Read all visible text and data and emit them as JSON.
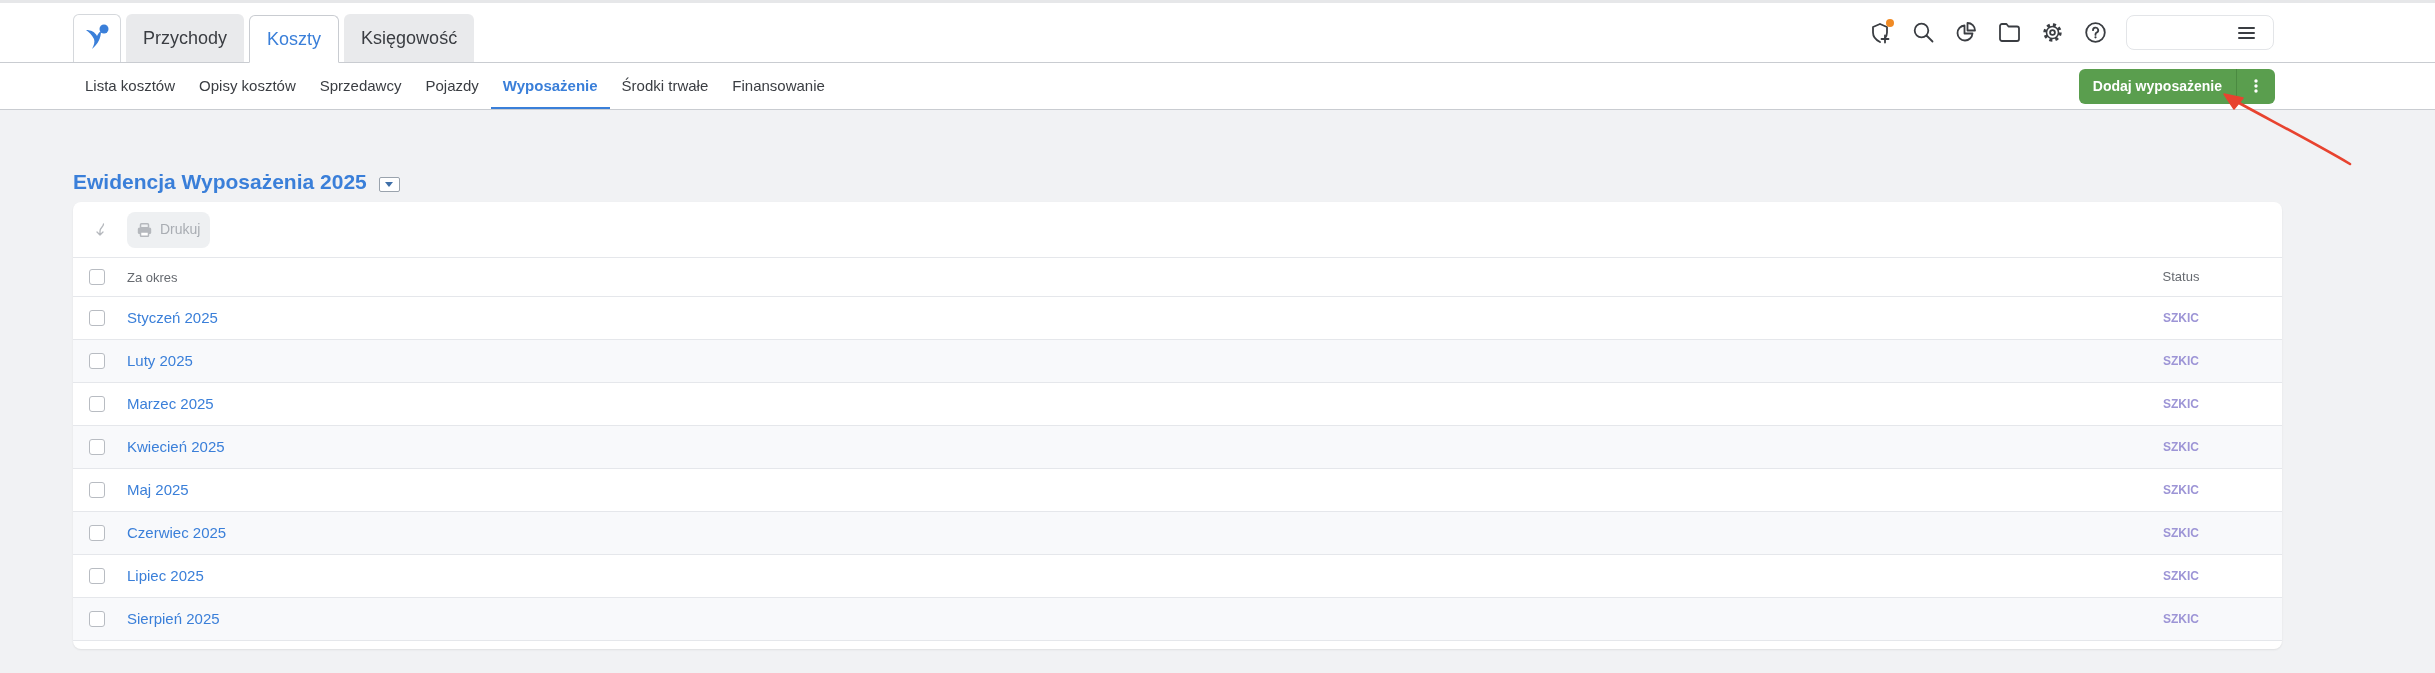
{
  "header": {
    "tabs": [
      {
        "label": "Przychody",
        "selected": false
      },
      {
        "label": "Koszty",
        "selected": true
      },
      {
        "label": "Księgowość",
        "selected": false
      }
    ],
    "alert_badge": true
  },
  "subnav": {
    "items": [
      {
        "label": "Lista kosztów",
        "selected": false
      },
      {
        "label": "Opisy kosztów",
        "selected": false
      },
      {
        "label": "Sprzedawcy",
        "selected": false
      },
      {
        "label": "Pojazdy",
        "selected": false
      },
      {
        "label": "Wyposażenie",
        "selected": true
      },
      {
        "label": "Środki trwałe",
        "selected": false
      },
      {
        "label": "Finansowanie",
        "selected": false
      }
    ],
    "primary_action": {
      "label": "Dodaj wyposażenie"
    }
  },
  "register": {
    "title": "Ewidencja Wyposażenia 2025",
    "toolbar": {
      "print": {
        "label": "Drukuj",
        "disabled": true
      }
    },
    "table": {
      "columns": [
        "Za okres",
        "Status"
      ],
      "header_checked": false,
      "rows": [
        {
          "period": "Styczeń 2025",
          "status": "SZKIC",
          "checked": false
        },
        {
          "period": "Luty 2025",
          "status": "SZKIC",
          "checked": false
        },
        {
          "period": "Marzec 2025",
          "status": "SZKIC",
          "checked": false
        },
        {
          "period": "Kwiecień 2025",
          "status": "SZKIC",
          "checked": false
        },
        {
          "period": "Maj 2025",
          "status": "SZKIC",
          "checked": false
        },
        {
          "period": "Czerwiec 2025",
          "status": "SZKIC",
          "checked": false
        },
        {
          "period": "Lipiec 2025",
          "status": "SZKIC",
          "checked": false
        },
        {
          "period": "Sierpień 2025",
          "status": "SZKIC",
          "checked": false
        }
      ]
    }
  }
}
